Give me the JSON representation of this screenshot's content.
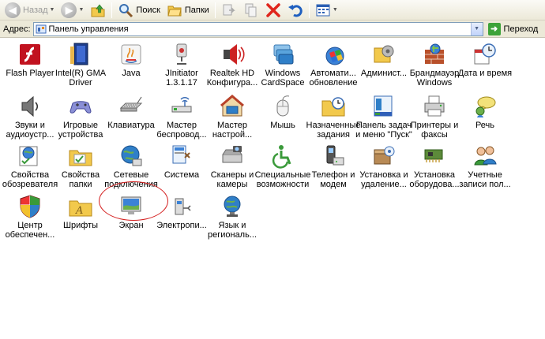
{
  "toolbar": {
    "back_label": "Назад",
    "search_label": "Поиск",
    "folders_label": "Папки"
  },
  "address": {
    "label": "Адрес:",
    "path": "Панель управления",
    "go_label": "Переход"
  },
  "items": [
    {
      "l1": "Flash Player",
      "l2": "",
      "icon": "flash-icon"
    },
    {
      "l1": "Intel(R) GMA",
      "l2": "Driver",
      "icon": "intel-gma-icon"
    },
    {
      "l1": "Java",
      "l2": "",
      "icon": "java-icon"
    },
    {
      "l1": "JInitiator",
      "l2": "1.3.1.17",
      "icon": "jinitiator-icon"
    },
    {
      "l1": "Realtek HD",
      "l2": "Конфигура...",
      "icon": "realtek-icon"
    },
    {
      "l1": "Windows",
      "l2": "CardSpace",
      "icon": "cardspace-icon"
    },
    {
      "l1": "Автомати...",
      "l2": "обновление",
      "icon": "windows-update-icon"
    },
    {
      "l1": "Админист...",
      "l2": "",
      "icon": "admin-tools-icon"
    },
    {
      "l1": "Брандмауэр",
      "l2": "Windows",
      "icon": "firewall-icon"
    },
    {
      "l1": "Дата и время",
      "l2": "",
      "icon": "clock-icon"
    },
    {
      "l1": "Звуки и",
      "l2": "аудиоустр...",
      "icon": "speaker-icon"
    },
    {
      "l1": "Игровые",
      "l2": "устройства",
      "icon": "gamepad-icon"
    },
    {
      "l1": "Клавиатура",
      "l2": "",
      "icon": "keyboard-icon"
    },
    {
      "l1": "Мастер",
      "l2": "беспровод...",
      "icon": "wireless-icon"
    },
    {
      "l1": "Мастер",
      "l2": "настрой...",
      "icon": "network-setup-icon"
    },
    {
      "l1": "Мышь",
      "l2": "",
      "icon": "mouse-icon"
    },
    {
      "l1": "Назначенные",
      "l2": "задания",
      "icon": "scheduled-tasks-icon"
    },
    {
      "l1": "Панель задач",
      "l2": "и меню \"Пуск\"",
      "icon": "taskbar-icon"
    },
    {
      "l1": "Принтеры и",
      "l2": "факсы",
      "icon": "printer-icon"
    },
    {
      "l1": "Речь",
      "l2": "",
      "icon": "speech-icon"
    },
    {
      "l1": "Свойства",
      "l2": "обозревателя",
      "icon": "internet-options-icon"
    },
    {
      "l1": "Свойства",
      "l2": "папки",
      "icon": "folder-options-icon"
    },
    {
      "l1": "Сетевые",
      "l2": "подключения",
      "icon": "network-connections-icon"
    },
    {
      "l1": "Система",
      "l2": "",
      "icon": "system-icon"
    },
    {
      "l1": "Сканеры и",
      "l2": "камеры",
      "icon": "scanner-icon"
    },
    {
      "l1": "Специальные",
      "l2": "возможности",
      "icon": "accessibility-icon"
    },
    {
      "l1": "Телефон и",
      "l2": "модем",
      "icon": "phone-modem-icon"
    },
    {
      "l1": "Установка и",
      "l2": "удаление...",
      "icon": "add-remove-icon"
    },
    {
      "l1": "Установка",
      "l2": "оборудова...",
      "icon": "add-hardware-icon"
    },
    {
      "l1": "Учетные",
      "l2": "записи пол...",
      "icon": "user-accounts-icon"
    },
    {
      "l1": "Центр",
      "l2": "обеспечен...",
      "icon": "security-center-icon"
    },
    {
      "l1": "Шрифты",
      "l2": "",
      "icon": "fonts-icon"
    },
    {
      "l1": "Экран",
      "l2": "",
      "icon": "display-icon"
    },
    {
      "l1": "Электропи...",
      "l2": "",
      "icon": "power-icon"
    },
    {
      "l1": "Язык и",
      "l2": "региональ...",
      "icon": "regional-icon"
    }
  ],
  "colors": {
    "toolbar_bg": "#ece9d8",
    "address_border": "#7f9db9",
    "highlight_circle": "#d42020",
    "go_green": "#3da33a"
  }
}
